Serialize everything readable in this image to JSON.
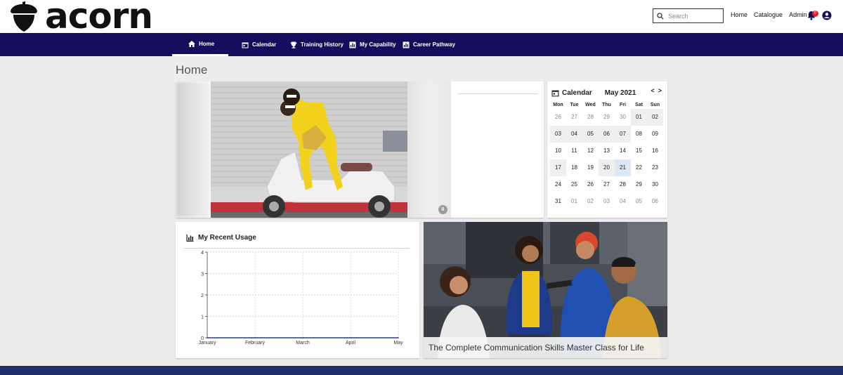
{
  "brand": {
    "name": "acorn",
    "logo_icon": "acorn-icon"
  },
  "header": {
    "search_placeholder": "Search",
    "links": [
      "Home",
      "Catalogue",
      "Admin"
    ],
    "notification_count": "0"
  },
  "nav": {
    "items": [
      {
        "label": "Home",
        "icon": "home-icon",
        "active": true
      },
      {
        "label": "Calendar",
        "icon": "calendar-icon"
      },
      {
        "label": "Training History",
        "icon": "trophy-icon"
      },
      {
        "label": "My Capability",
        "icon": "bar-chart-icon"
      },
      {
        "label": "Career Pathway",
        "icon": "bar-chart-icon"
      }
    ]
  },
  "page": {
    "title": "Home"
  },
  "calendar": {
    "title": "Calendar",
    "month": "May 2021",
    "prev": "<",
    "next": ">",
    "weekdays": [
      "Mon",
      "Tue",
      "Wed",
      "Thu",
      "Fri",
      "Sat",
      "Sun"
    ],
    "days": [
      [
        "26",
        "27",
        "28",
        "29",
        "30",
        "01",
        "02"
      ],
      [
        "03",
        "04",
        "05",
        "06",
        "07",
        "08",
        "09"
      ],
      [
        "10",
        "11",
        "12",
        "13",
        "14",
        "15",
        "16"
      ],
      [
        "17",
        "18",
        "19",
        "20",
        "21",
        "22",
        "23"
      ],
      [
        "24",
        "25",
        "26",
        "27",
        "28",
        "29",
        "30"
      ],
      [
        "31",
        "01",
        "02",
        "03",
        "04",
        "05",
        "06"
      ]
    ],
    "today": "21"
  },
  "usage": {
    "title": "My Recent Usage"
  },
  "chart_data": {
    "type": "line",
    "title": "My Recent Usage",
    "categories": [
      "January",
      "February",
      "March",
      "April",
      "May"
    ],
    "series": [
      {
        "values": [
          0,
          0,
          0,
          0,
          0
        ],
        "color": "#2a3a8a"
      }
    ],
    "ylim": [
      0,
      4
    ],
    "yticks": [
      "0",
      "1",
      "2",
      "3",
      "4"
    ],
    "grid": true
  },
  "course": {
    "title": "The Complete Communication Skills Master Class for Life"
  },
  "colors": {
    "nav": "#150d5c",
    "footer": "#1e2f6a",
    "badge": "#e02020"
  }
}
